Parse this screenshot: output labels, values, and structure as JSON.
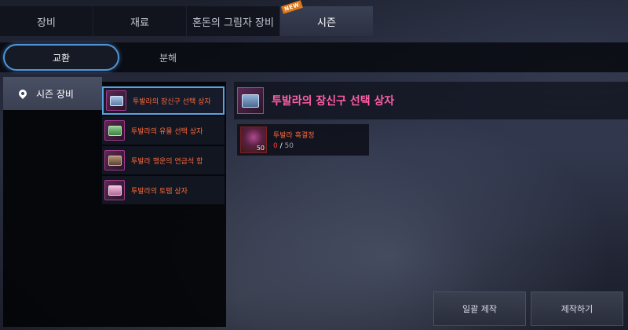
{
  "top_tabs": [
    {
      "label": "장비"
    },
    {
      "label": "재료"
    },
    {
      "label": "혼돈의 그림자 장비"
    },
    {
      "label": "시즌",
      "badge": "NEW"
    }
  ],
  "active_top_tab": "시즌",
  "sub_tabs": [
    {
      "label": "교환"
    },
    {
      "label": "분해"
    }
  ],
  "category": {
    "label": "시즌 장비",
    "icon": "location-pin-icon"
  },
  "items": [
    {
      "label": "투발라의 장신구 선택 상자",
      "icon": "jewelry-chest-icon",
      "chest_color": "#7fa6d6"
    },
    {
      "label": "투발라의 유물 선택 상자",
      "icon": "relic-chest-icon",
      "chest_color": "#5fae6a"
    },
    {
      "label": "투발라 행운의 연금석 함",
      "icon": "alchemy-stone-box-icon",
      "chest_color": "#8a6a52"
    },
    {
      "label": "투발라의 토템 상자",
      "icon": "totem-chest-icon",
      "chest_color": "#e2a0c8"
    }
  ],
  "detail": {
    "title": "투발라의 장신구 선택 상자",
    "material": {
      "name": "투발라 흑결정",
      "qty_badge": "50",
      "have": "0",
      "separator": "/",
      "need": "50"
    }
  },
  "buttons": {
    "bulk_craft": "일괄 제작",
    "craft": "제작하기"
  },
  "colors": {
    "accent_blue": "#4f93d8",
    "item_name_orange": "#ff6a3a",
    "title_pink": "#ff5fa8"
  }
}
